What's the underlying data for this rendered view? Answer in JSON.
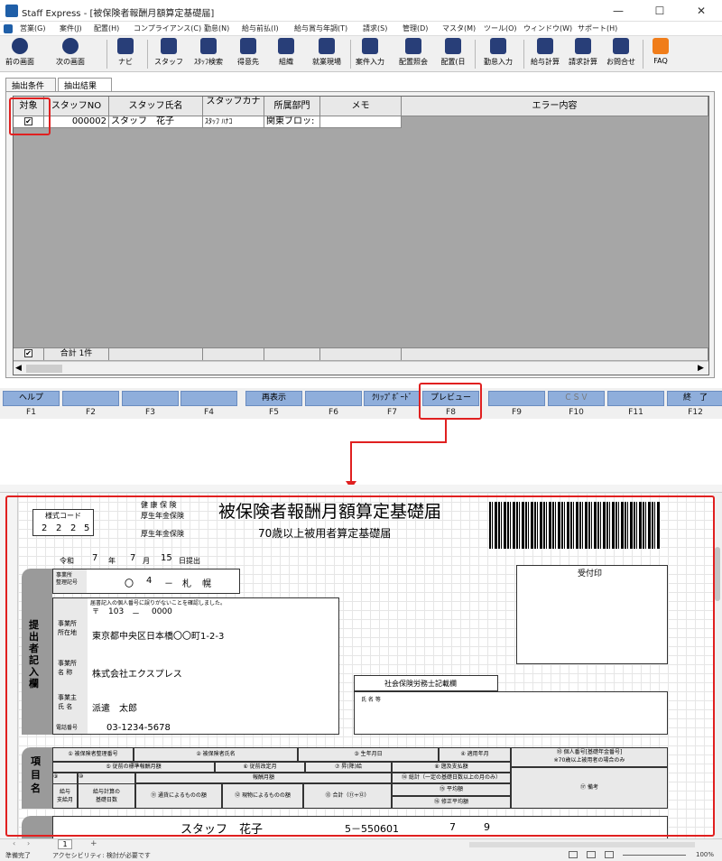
{
  "window": {
    "title": "Staff Express - [被保険者報酬月額算定基礎届]",
    "minimize": "—",
    "maximize": "☐",
    "close": "✕"
  },
  "menu": [
    "営業(G)",
    "案件(J)",
    "配置(H)",
    "コンプライアンス(C)",
    "勤怠(N)",
    "給与前払(I)",
    "給与賞与年調(T)",
    "請求(S)",
    "管理(D)",
    "マスタ(M)",
    "ツール(O)",
    "ウィンドウ(W)",
    "サポート(H)"
  ],
  "toolbar": [
    {
      "label": "前の画面",
      "icon": "back-arrow-icon"
    },
    {
      "label": "次の画面",
      "icon": "forward-arrow-icon"
    },
    {
      "label": "ナビ",
      "icon": "navi-icon"
    },
    {
      "label": "スタッフ",
      "icon": "staff-icon"
    },
    {
      "label": "ｽﾀｯﾌ検索",
      "icon": "staff-search-icon"
    },
    {
      "label": "得意先",
      "icon": "customer-icon"
    },
    {
      "label": "組織",
      "icon": "organization-icon"
    },
    {
      "label": "就業現場",
      "icon": "workplace-icon"
    },
    {
      "label": "案件入力",
      "icon": "case-entry-icon"
    },
    {
      "label": "配置照会",
      "icon": "assignment-inquiry-icon"
    },
    {
      "label": "配置(日",
      "icon": "assignment-daily-icon"
    },
    {
      "label": "勤怠入力",
      "icon": "attendance-entry-icon"
    },
    {
      "label": "給与計算",
      "icon": "payroll-icon"
    },
    {
      "label": "請求計算",
      "icon": "billing-icon"
    },
    {
      "label": "お問合せ",
      "icon": "inquiry-icon"
    },
    {
      "label": "FAQ",
      "icon": "faq-icon"
    }
  ],
  "tabs": [
    "抽出条件",
    "抽出結果"
  ],
  "grid": {
    "headers": [
      "対象",
      "スタッフNO",
      "スタッフ氏名",
      "スタッフカナ",
      "所属部門",
      "メモ",
      "エラー内容"
    ],
    "row": {
      "checked": "✔",
      "staff_no": "000002",
      "name": "スタッフ　花子",
      "kana": "ｽﾀｯﾌ ﾊﾅｺ",
      "dept": "関東ブロッ:",
      "memo": "",
      "error": ""
    },
    "footer": {
      "checked": "✔",
      "total": "合計 1件"
    }
  },
  "fkeys": [
    {
      "label": "ヘルプ",
      "key": "F1"
    },
    {
      "label": "",
      "key": "F2"
    },
    {
      "label": "",
      "key": "F3"
    },
    {
      "label": "",
      "key": "F4"
    },
    {
      "label": "再表示",
      "key": "F5"
    },
    {
      "label": "",
      "key": "F6"
    },
    {
      "label": "ｸﾘｯﾌﾟﾎﾞｰﾄﾞ",
      "key": "F7"
    },
    {
      "label": "プレビュー",
      "key": "F8"
    },
    {
      "label": "",
      "key": "F9"
    },
    {
      "label": "ＣＳＶ",
      "key": "F10"
    },
    {
      "label": "",
      "key": "F11"
    },
    {
      "label": "終　了",
      "key": "F12"
    }
  ],
  "form": {
    "format_code_label": "様式コード",
    "format_code": [
      "2",
      "2",
      "2",
      "5"
    ],
    "insurance1": "健 康 保 険",
    "insurance2": "厚生年金保険",
    "insurance3": "厚生年金保険",
    "title": "被保険者報酬月額算定基礎届",
    "subtitle": "70歳以上被用者算定基礎届",
    "era": "令和",
    "year": "7",
    "year_unit": "年",
    "month": "7",
    "month_unit": "月",
    "day": "15",
    "day_unit": "日提出",
    "received_stamp": "受付印",
    "office_code_label": "事業所\n整理記号",
    "office_code": [
      "",
      "〇",
      "4",
      "－",
      "札",
      "幌"
    ],
    "submitter_label": "提出者記入欄",
    "confirm_note": "届書記入の個人番号に誤りがないことを確認しました。",
    "postal_mark": "〒",
    "postal1": "103",
    "postal_dash": "－",
    "postal2": "0000",
    "address_label": "事業所\n所在地",
    "address": "東京都中央区日本橋〇〇町1-2-3",
    "office_name_label": "事業所\n名 称",
    "office_name": "株式会社エクスプレス",
    "owner_label": "事業主\n氏 名",
    "owner_name": "派遣　太郎",
    "phone_label": "電話番号",
    "phone": "03-1234-5678",
    "sharoushi_label": "社会保険労務士記載欄",
    "sharoushi_name_label": "氏 名 等",
    "items_label": "項目名",
    "cols": {
      "c1": "① 被保険者整理番号",
      "c2": "② 被保険者氏名",
      "c3": "③ 生年月日",
      "c4": "④ 適用年月",
      "c5": "⑱ 個人番号[基礎年金番号]\n※70歳以上被用者の場合のみ",
      "c6": "⑤ 従前の標準報酬月額",
      "c7": "⑥ 従前改定月",
      "c8": "⑦ 昇(降)給",
      "c9": "⑧ 遡及支払額",
      "c10": "⑨",
      "c11": "報酬月額",
      "c12": "⑭ 総計（一定の基礎日数以上の月のみ）",
      "c13": "給与\n支給月",
      "c14": "給与計算の\n基礎日数",
      "c15": "⑪ 通貨によるものの額",
      "c16": "⑫ 現物によるものの額",
      "c17": "⑬ 合計（⑪+⑫）",
      "c18": "⑮ 平均額",
      "c19": "⑯ 修正平均額",
      "c20": "⑰ 備考",
      "c21": "⑩"
    },
    "row_name": "スタッフ　花子",
    "row_birth": "5－550601",
    "row_y": "7",
    "row_m": "9"
  },
  "excel": {
    "sheet_tab": "1",
    "add_sheet": "+",
    "status_ready": "準備完了",
    "status_accessibility": "アクセシビリティ: 検討が必要です",
    "zoom": "100%"
  }
}
